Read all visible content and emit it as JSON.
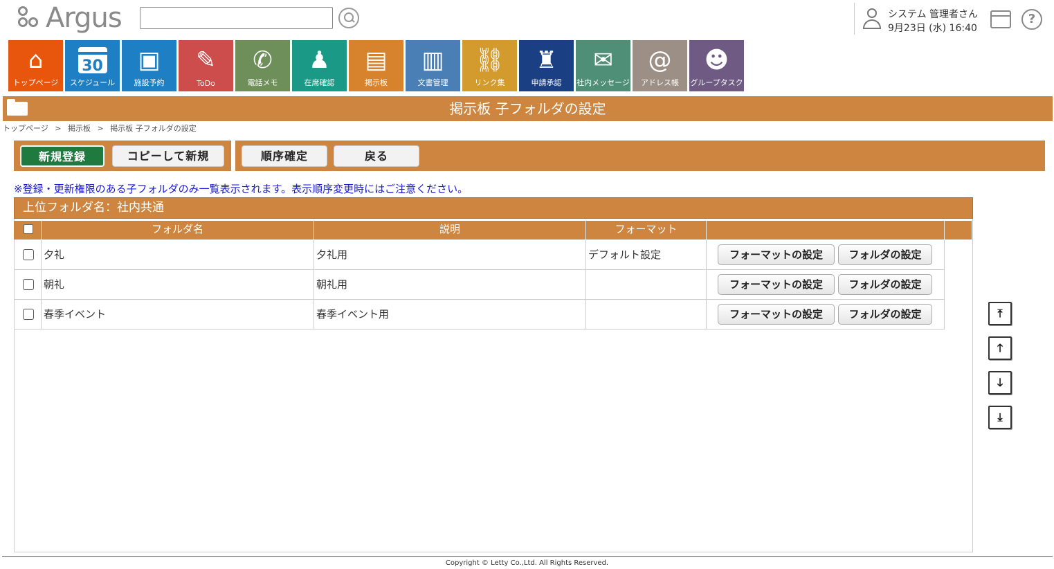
{
  "header": {
    "logo_text": "Argus",
    "search": {
      "value": "",
      "placeholder": ""
    },
    "user_name": "システム 管理者さん",
    "datetime": "9月23日 (水) 16:40",
    "help_glyph": "?"
  },
  "apps": [
    {
      "label": "トップページ",
      "color": "#e8560e",
      "icon": "home-icon"
    },
    {
      "label": "スケジュール",
      "color": "#1f7fc4",
      "icon": "calendar-icon",
      "icon_text": "30"
    },
    {
      "label": "施設予約",
      "color": "#1f7fc4",
      "icon": "facility-icon"
    },
    {
      "label": "ToDo",
      "color": "#cd4d4d",
      "icon": "todo-icon"
    },
    {
      "label": "電話メモ",
      "color": "#6e8f5a",
      "icon": "phone-icon"
    },
    {
      "label": "在席確認",
      "color": "#1a9a86",
      "icon": "attendance-icon"
    },
    {
      "label": "掲示板",
      "color": "#d7822c",
      "icon": "board-icon"
    },
    {
      "label": "文書管理",
      "color": "#4a7fb5",
      "icon": "document-icon"
    },
    {
      "label": "リンク集",
      "color": "#d39a2e",
      "icon": "link-icon"
    },
    {
      "label": "申請承認",
      "color": "#1b3f83",
      "icon": "stamp-icon"
    },
    {
      "label": "社内メッセージ",
      "color": "#4f8f78",
      "icon": "message-icon"
    },
    {
      "label": "アドレス帳",
      "color": "#9c8f86",
      "icon": "address-book-icon"
    },
    {
      "label": "グループタスク",
      "color": "#6e5a82",
      "icon": "group-task-icon"
    }
  ],
  "page": {
    "title": "掲示板 子フォルダの設定",
    "breadcrumb": [
      "トップページ",
      ">",
      "掲示板",
      ">",
      "掲示板 子フォルダの設定"
    ]
  },
  "toolbar": {
    "new_label": "新規登録",
    "copy_label": "コピーして新規",
    "order_label": "順序確定",
    "back_label": "戻る"
  },
  "notice": "※登録・更新権限のある子フォルダのみ一覧表示されます。表示順序変更時にはご注意ください。",
  "parent_folder": "上位フォルダ名：社内共通",
  "table": {
    "headers": {
      "name": "フォルダ名",
      "desc": "説明",
      "format": "フォーマット"
    },
    "format_btn": "フォーマットの設定",
    "folder_btn": "フォルダの設定",
    "rows": [
      {
        "name": "夕礼",
        "desc": "夕礼用",
        "format": "デフォルト設定"
      },
      {
        "name": "朝礼",
        "desc": "朝礼用",
        "format": ""
      },
      {
        "name": "春季イベント",
        "desc": "春季イベント用",
        "format": ""
      }
    ]
  },
  "order_buttons": [
    {
      "name": "move-top-icon",
      "glyph": "⤒"
    },
    {
      "name": "move-up-icon",
      "glyph": "🡑"
    },
    {
      "name": "move-down-icon",
      "glyph": "🡓"
    },
    {
      "name": "move-bottom-icon",
      "glyph": "⤓"
    }
  ],
  "footer": {
    "copyright": "Copyright © Letty Co.,Ltd. All Rights Reserved."
  }
}
